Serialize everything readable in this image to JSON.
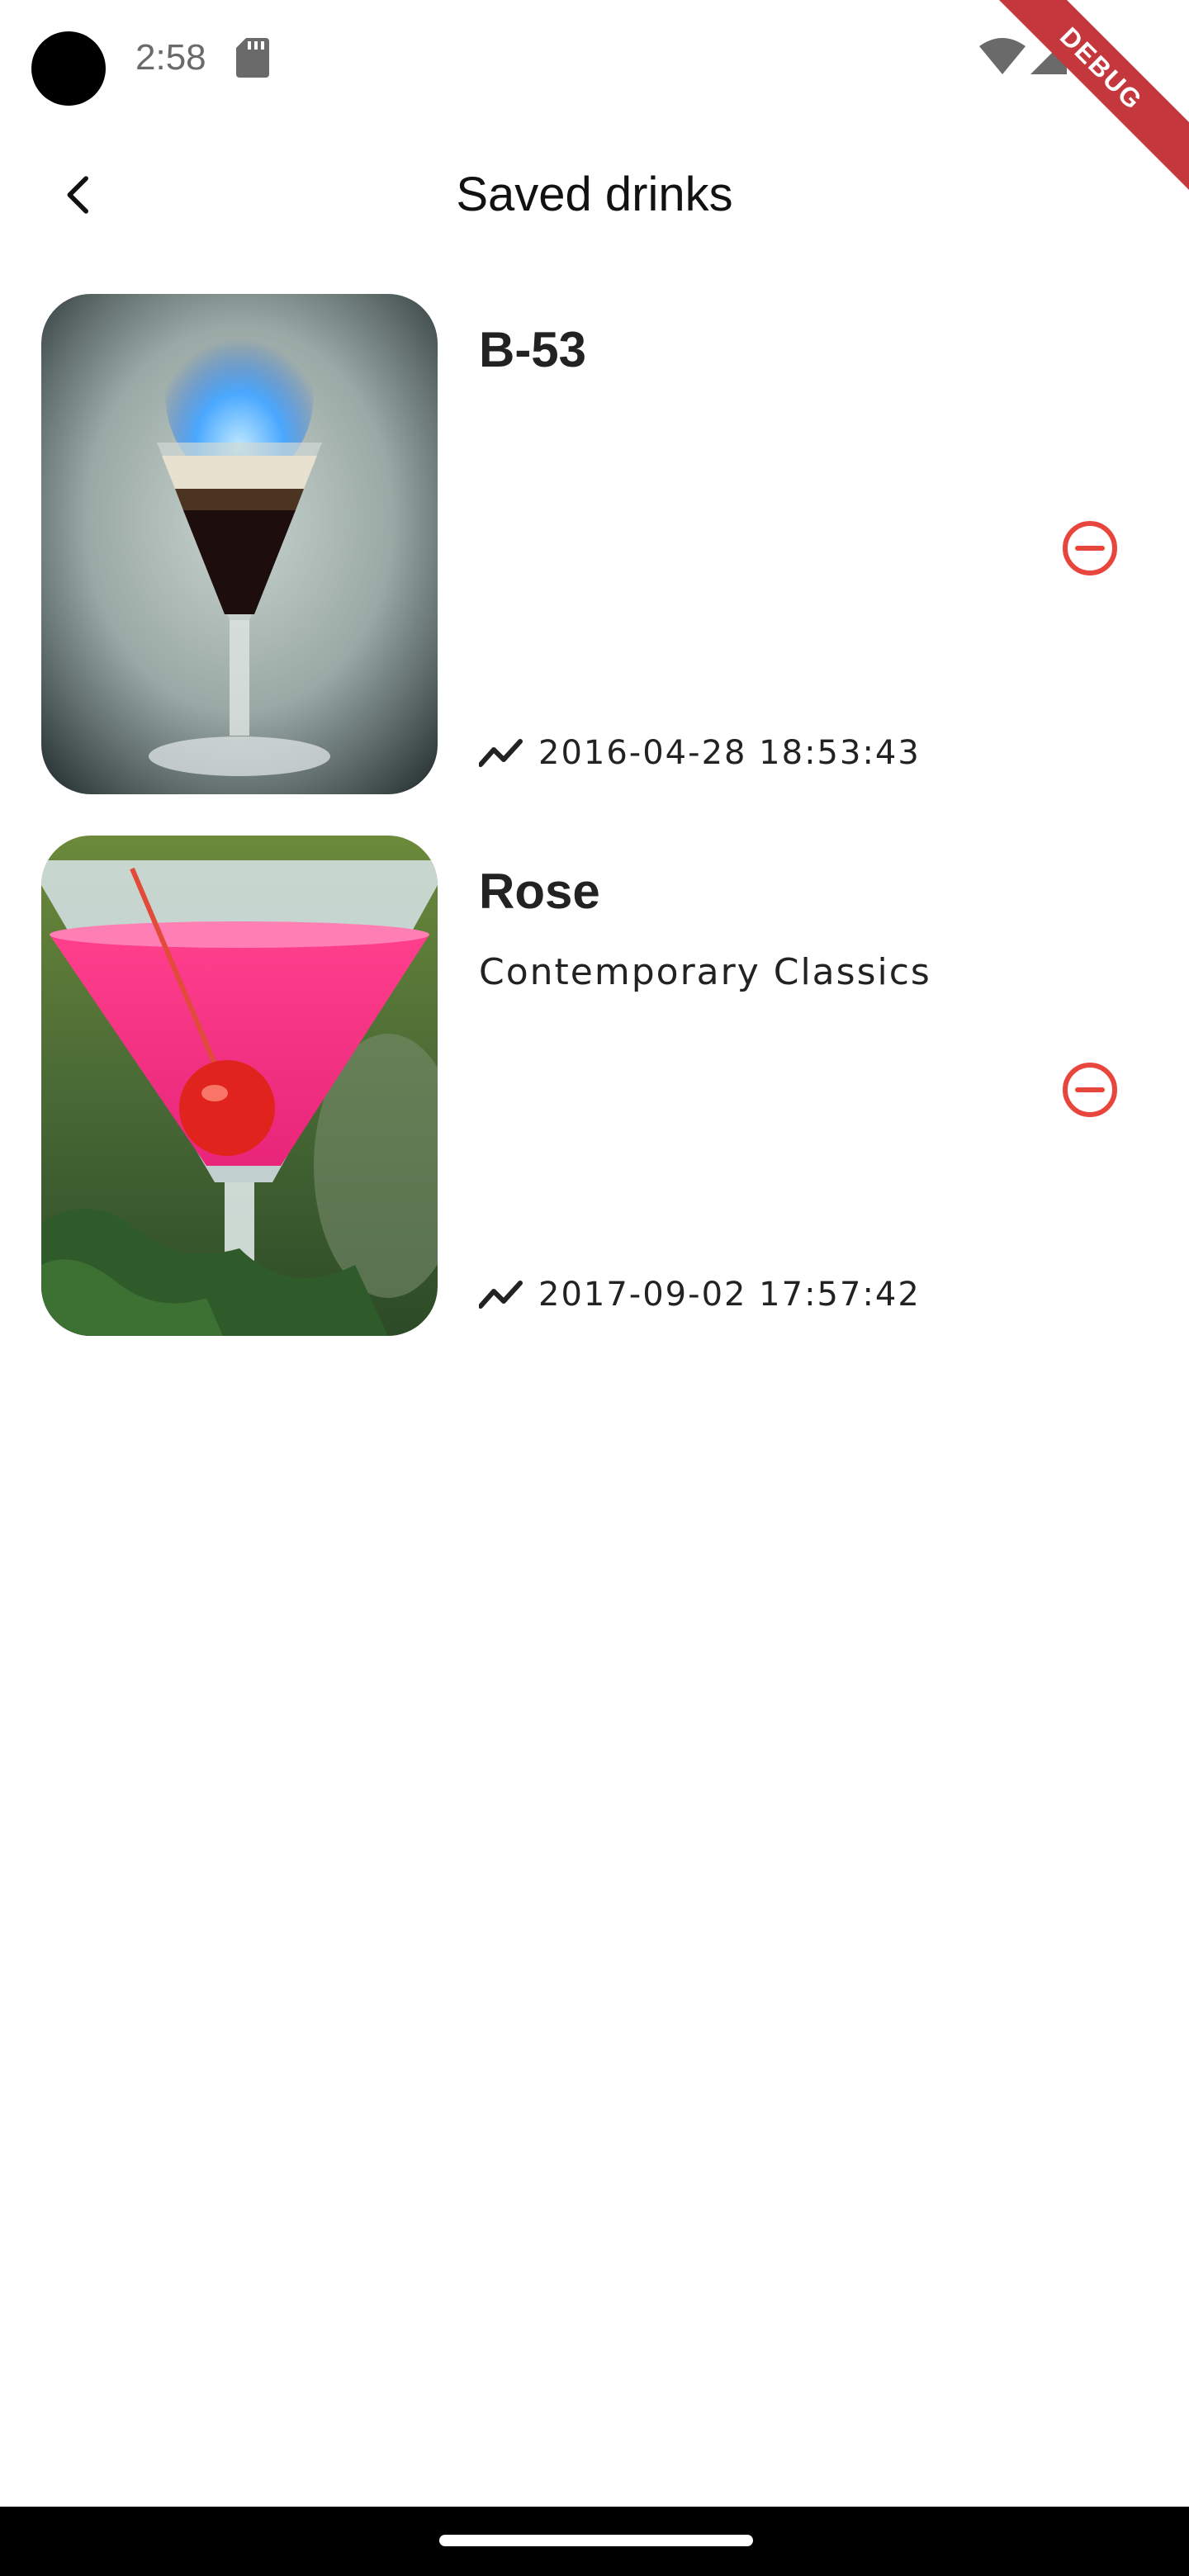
{
  "status_bar": {
    "time": "2:58",
    "icons": [
      "sd-card-icon",
      "wifi-icon",
      "signal-icon",
      "battery-icon"
    ]
  },
  "debug_banner": "DEBUG",
  "app_bar": {
    "back_icon": "arrow-back-icon",
    "title": "Saved drinks"
  },
  "drinks": [
    {
      "name": "B-53",
      "category": "",
      "date": "2016-04-28 18:53:43",
      "image": "flaming-layered-shot",
      "date_icon": "trending-icon",
      "remove_icon": "remove-circle-icon"
    },
    {
      "name": "Rose",
      "category": "Contemporary Classics",
      "date": "2017-09-02 17:57:42",
      "image": "pink-martini-with-cherry",
      "date_icon": "trending-icon",
      "remove_icon": "remove-circle-icon"
    }
  ],
  "colors": {
    "remove_accent": "#e8463d",
    "ribbon": "#c4373d",
    "text_primary": "#222222"
  }
}
